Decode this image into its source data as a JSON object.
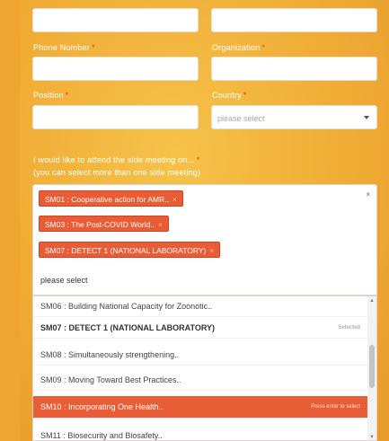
{
  "form": {
    "phone_label": "Phone Number",
    "organization_label": "Organization",
    "position_label": "Position",
    "country_label": "Country",
    "required_mark": "*",
    "country_placeholder": "please select",
    "side_meeting_label": "I would like to attend the side meeting on...",
    "side_meeting_hint": "(you can select more than one side meeting)"
  },
  "multi_select": {
    "selected": [
      {
        "label": "SM01 : Cooperative action for AMR..",
        "remove": "×"
      },
      {
        "label": "SM03 : The Post-COVID World..",
        "remove": "×"
      },
      {
        "label": "SM07 : DETECT 1 (NATIONAL LABORATORY)",
        "remove": "×"
      }
    ],
    "placeholder": "please select",
    "toggle": "×"
  },
  "dropdown": {
    "options": [
      {
        "label": "SM06 : Building National Capacity for Zoonotic..",
        "hint": ""
      },
      {
        "label": "SM07 : DETECT 1 (NATIONAL LABORATORY)",
        "hint": "Selected"
      },
      {
        "label": "SM08 : Simultaneously strengthening..",
        "hint": ""
      },
      {
        "label": "SM09 : Moving Toward Best Practices..",
        "hint": ""
      },
      {
        "label": "SM10 : Incorporating One Health..",
        "hint": "Press enter to select"
      },
      {
        "label": "SM11 : Biosecurity and Biosafety..",
        "hint": ""
      }
    ]
  },
  "colors": {
    "accent": "#e85c36",
    "background": "#f0ad36"
  }
}
